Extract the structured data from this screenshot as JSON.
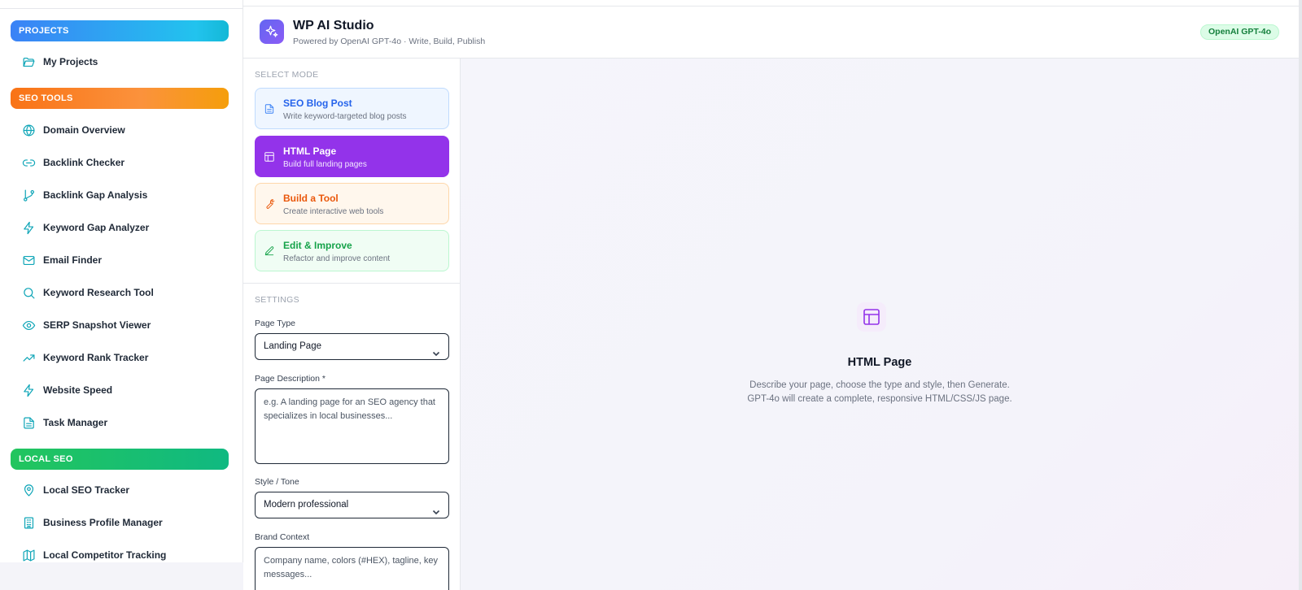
{
  "sidebar": {
    "sections": {
      "projects": "PROJECTS",
      "seo_tools": "SEO TOOLS",
      "local_seo": "LOCAL SEO"
    },
    "items": {
      "my_projects": "My Projects",
      "domain_overview": "Domain Overview",
      "backlink_checker": "Backlink Checker",
      "backlink_gap": "Backlink Gap Analysis",
      "keyword_gap": "Keyword Gap Analyzer",
      "email_finder": "Email Finder",
      "keyword_research": "Keyword Research Tool",
      "serp_snapshot": "SERP Snapshot Viewer",
      "rank_tracker": "Keyword Rank Tracker",
      "website_speed": "Website Speed",
      "task_manager": "Task Manager",
      "local_seo_tracker": "Local SEO Tracker",
      "business_profile": "Business Profile Manager",
      "local_competitor": "Local Competitor Tracking"
    }
  },
  "header": {
    "title": "WP AI Studio",
    "subtitle": "Powered by OpenAI GPT-4o · Write, Build, Publish",
    "badge": "OpenAI GPT-4o"
  },
  "panel": {
    "select_mode_label": "SELECT MODE",
    "modes": {
      "blog": {
        "title": "SEO Blog Post",
        "desc": "Write keyword-targeted blog posts"
      },
      "html": {
        "title": "HTML Page",
        "desc": "Build full landing pages"
      },
      "tool": {
        "title": "Build a Tool",
        "desc": "Create interactive web tools"
      },
      "edit": {
        "title": "Edit & Improve",
        "desc": "Refactor and improve content"
      }
    },
    "settings_label": "SETTINGS",
    "page_type": {
      "label": "Page Type",
      "value": "Landing Page"
    },
    "page_description": {
      "label": "Page Description *",
      "placeholder": "e.g. A landing page for an SEO agency that specializes in local businesses..."
    },
    "style_tone": {
      "label": "Style / Tone",
      "value": "Modern professional"
    },
    "brand_context": {
      "label": "Brand Context",
      "placeholder": "Company name, colors (#HEX), tagline, key messages..."
    }
  },
  "preview": {
    "title": "HTML Page",
    "desc_line1": "Describe your page, choose the type and style, then Generate.",
    "desc_line2": "GPT-4o will create a complete, responsive HTML/CSS/JS page."
  },
  "colors": {
    "accent_purple": "#9333ea",
    "nav_icon": "#0ea5b7",
    "badge_green": "#15803d"
  }
}
